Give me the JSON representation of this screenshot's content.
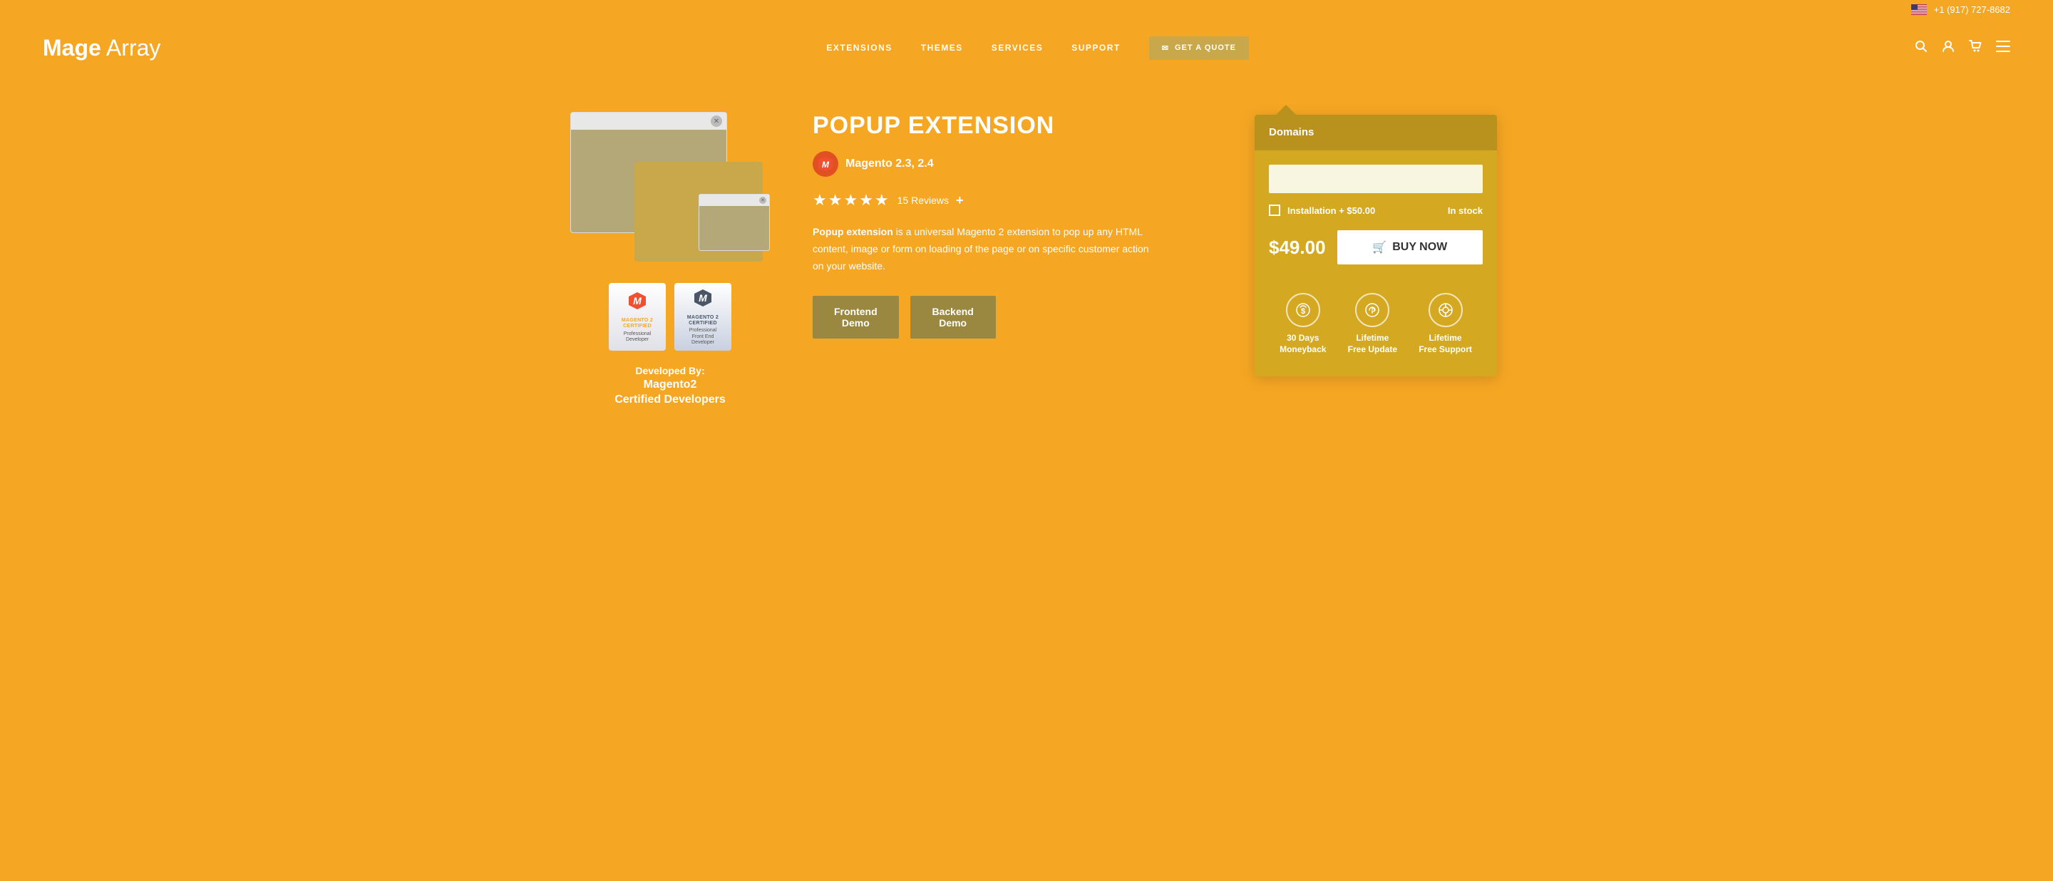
{
  "header": {
    "phone": "+1 (917) 727-8682",
    "logo": {
      "bold": "Mage",
      "regular": " Array"
    },
    "nav": {
      "items": [
        {
          "label": "EXTENSIONS"
        },
        {
          "label": "THEMES"
        },
        {
          "label": "SERVICES"
        },
        {
          "label": "SUPPORT"
        }
      ]
    },
    "quote_btn": "GET A QUOTE",
    "icons": {
      "search": "🔍",
      "user": "👤",
      "cart": "🛒",
      "menu": "☰"
    }
  },
  "product": {
    "title": "POPUP EXTENSION",
    "platform": "Magento 2.3, 2.4",
    "rating": {
      "stars": "★★★★★",
      "count": "15 Reviews",
      "plus": "+"
    },
    "description_bold": "Popup extension",
    "description_rest": " is a universal Magento 2 extension to pop up any HTML content, image or form on loading of the page or on specific customer action on your website.",
    "demo_buttons": {
      "frontend": "Frontend\nDemo",
      "backend": "Backend\nDemo"
    }
  },
  "purchase_card": {
    "domains_label": "Domains",
    "domain_placeholder": "",
    "installation_label": "Installation + $50.00",
    "in_stock": "In stock",
    "price": "$49.00",
    "buy_btn": "BUY NOW",
    "features": [
      {
        "label": "30 Days\nMoneyback"
      },
      {
        "label": "Lifetime\nFree Update"
      },
      {
        "label": "Lifetime\nFree Support"
      }
    ]
  },
  "developer": {
    "label": "Developed By:",
    "name_line1": "Magento2",
    "name_line2": "Certified Developers"
  },
  "badges": [
    {
      "title": "MAGENTO 2\nCERTIFIED",
      "subtitle": "Professional\nDeveloper"
    },
    {
      "title": "MAGENTO 2\nCERTIFIED",
      "subtitle": "Professional\nFront End\nDeveloper"
    }
  ]
}
